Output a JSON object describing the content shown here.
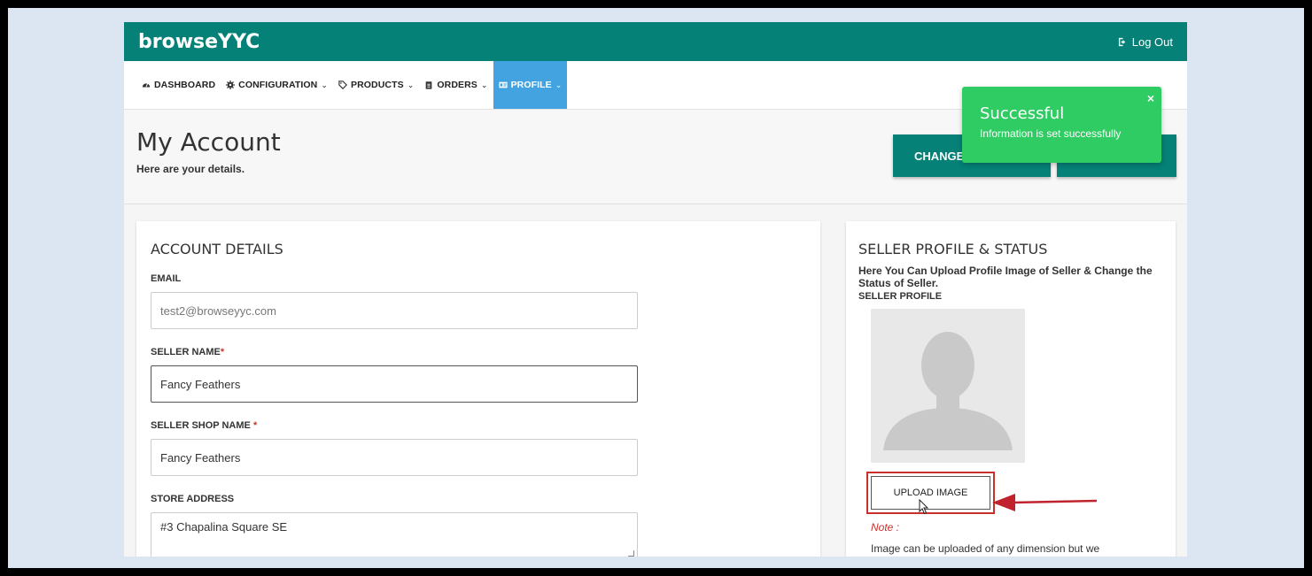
{
  "app": {
    "brand": "browseYYC",
    "logout_label": "Log Out"
  },
  "nav": {
    "items": [
      {
        "label": "DASHBOARD",
        "icon": "dashboard-icon",
        "has_dropdown": false
      },
      {
        "label": "CONFIGURATION",
        "icon": "gear-icon",
        "has_dropdown": true
      },
      {
        "label": "PRODUCTS",
        "icon": "tag-icon",
        "has_dropdown": true
      },
      {
        "label": "ORDERS",
        "icon": "clipboard-icon",
        "has_dropdown": true
      },
      {
        "label": "PROFILE",
        "icon": "id-card-icon",
        "has_dropdown": true,
        "active": true
      }
    ]
  },
  "header": {
    "title": "My Account",
    "subtitle": "Here are your details.",
    "button_1_label": "CHANGE"
  },
  "toast": {
    "title": "Successful",
    "message": "Information is set successfully",
    "close_label": "×"
  },
  "account": {
    "title": "ACCOUNT DETAILS",
    "email_label": "EMAIL",
    "email_value": "test2@browseyyc.com",
    "seller_name_label": "SELLER NAME",
    "seller_name_req": "*",
    "seller_name_value": "Fancy Feathers",
    "shop_name_label": "SELLER SHOP NAME",
    "shop_name_req": "*",
    "shop_name_value": "Fancy Feathers",
    "address_label": "STORE ADDRESS",
    "address_value": "#3 Chapalina Square SE"
  },
  "seller_profile": {
    "title": "SELLER PROFILE & STATUS",
    "description": "Here You Can Upload Profile Image of Seller & Change the Status of Seller.",
    "profile_label": "SELLER PROFILE",
    "upload_label": "UPLOAD IMAGE",
    "note_label": "Note :",
    "note_text": "Image can be uploaded of any dimension but we"
  },
  "colors": {
    "teal": "#058178",
    "active_nav": "#43a3e0",
    "toast": "#2ecc63",
    "highlight": "#c9302c"
  }
}
